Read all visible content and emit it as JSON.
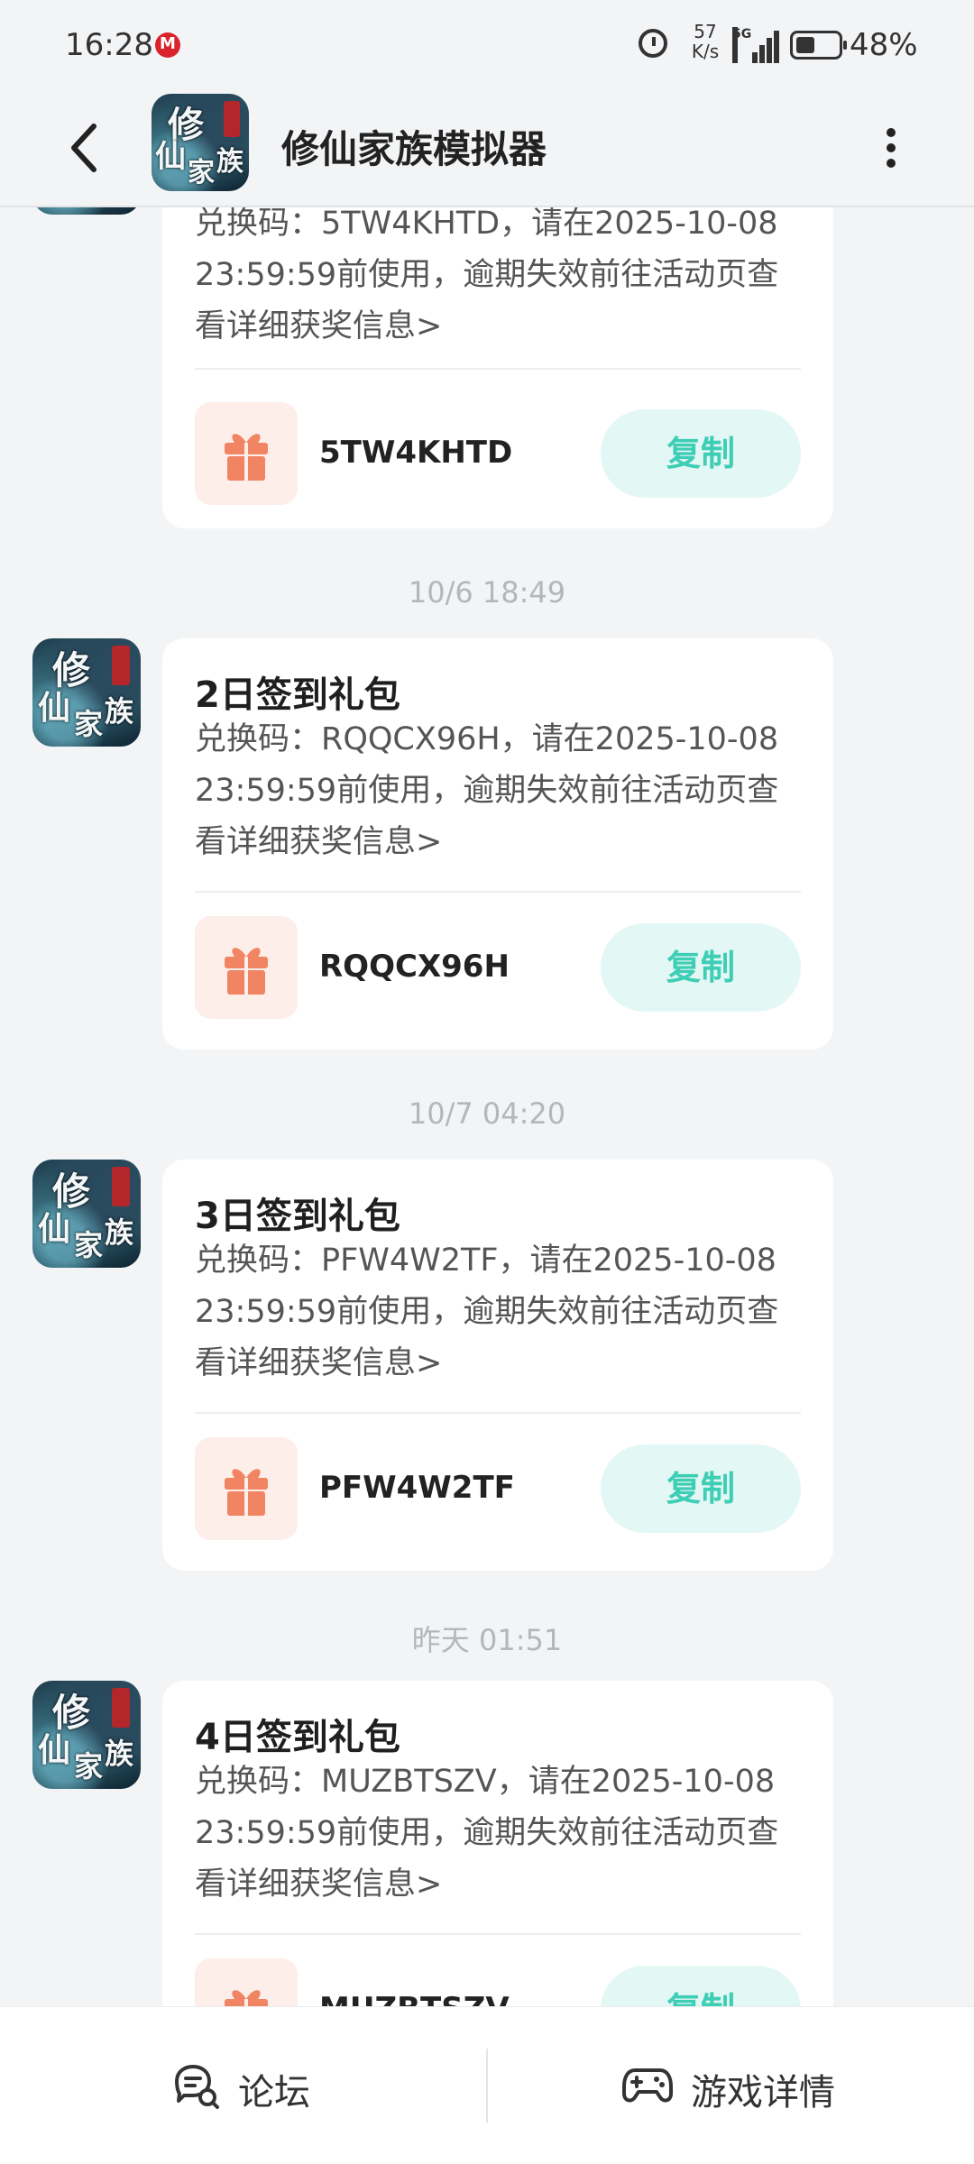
{
  "status_bar": {
    "time": "16:28",
    "speed_value": "57",
    "speed_unit": "K/s",
    "network": "5G",
    "battery_percent": "48%",
    "battery_level": 0.48
  },
  "header": {
    "title": "修仙家族模拟器",
    "app_icon_text": [
      "修",
      "仙",
      "家",
      "族"
    ]
  },
  "messages": [
    {
      "timestamp": "",
      "title": "",
      "body": "兑换码：5TW4KHTD，请在2025-10-08 23:59:59前使用，逾期失效前往活动页查看详细获奖信息>",
      "code": "5TW4KHTD",
      "copy_label": "复制"
    },
    {
      "timestamp": "10/6  18:49",
      "title": "2日签到礼包",
      "body": "兑换码：RQQCX96H，请在2025-10-08 23:59:59前使用，逾期失效前往活动页查看详细获奖信息>",
      "code": "RQQCX96H",
      "copy_label": "复制"
    },
    {
      "timestamp": "10/7  04:20",
      "title": "3日签到礼包",
      "body": "兑换码：PFW4W2TF，请在2025-10-08 23:59:59前使用，逾期失效前往活动页查看详细获奖信息>",
      "code": "PFW4W2TF",
      "copy_label": "复制"
    },
    {
      "timestamp": "昨天  01:51",
      "title": "4日签到礼包",
      "body": "兑换码：MUZBTSZV，请在2025-10-08 23:59:59前使用，逾期失效前往活动页查看详细获奖信息>",
      "code": "MUZBTSZV",
      "copy_label": "复制"
    }
  ],
  "bottom_nav": {
    "forum_label": "论坛",
    "game_details_label": "游戏详情"
  },
  "colors": {
    "background": "#f3f4f6",
    "copy_button_bg": "#e3f7f4",
    "copy_button_text": "#3ecdb5",
    "gift_tile_bg": "#fdeee9",
    "gift_icon": "#f08463",
    "timestamp_text": "#b4b6ba"
  },
  "icons": {
    "back": "back-arrow-icon",
    "more": "more-vertical-icon",
    "gift": "gift-icon",
    "forum": "forum-chat-icon",
    "game": "gamepad-icon"
  }
}
